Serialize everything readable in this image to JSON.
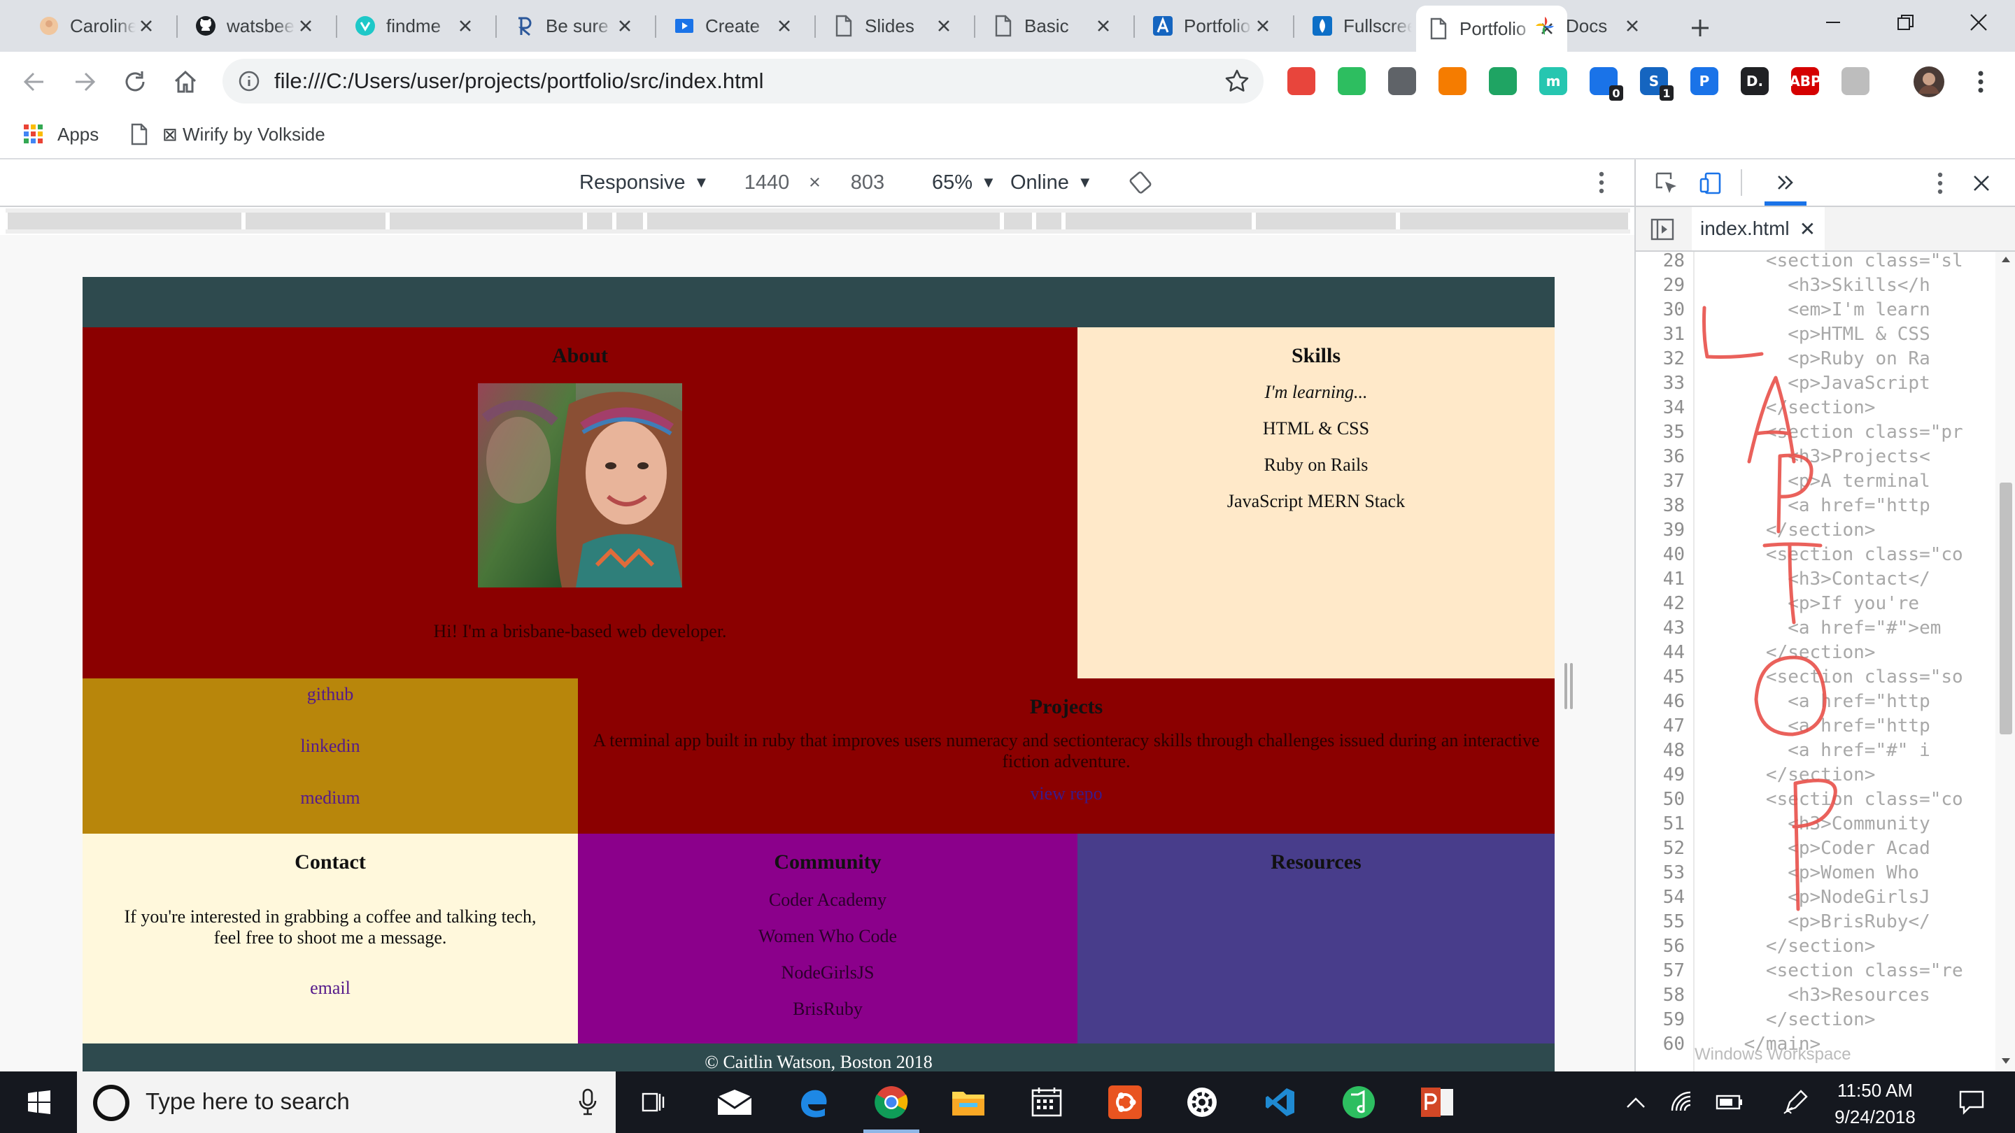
{
  "browser": {
    "tabs": [
      {
        "title": "Caroline",
        "icon": "avatar-favicon-icon"
      },
      {
        "title": "watsbeen",
        "icon": "github-icon"
      },
      {
        "title": "findme",
        "icon": "findme-favicon-icon"
      },
      {
        "title": "Be sure",
        "icon": "r-favicon-icon"
      },
      {
        "title": "Create",
        "icon": "video-favicon-icon"
      },
      {
        "title": "Slides",
        "icon": "page-icon"
      },
      {
        "title": "Basic",
        "icon": "page-icon"
      },
      {
        "title": "Portfolio",
        "icon": "a-favicon-icon"
      },
      {
        "title": "Fullscreen",
        "icon": "drop-favicon-icon"
      },
      {
        "title": "Portfolio",
        "icon": "page-icon",
        "active": true
      },
      {
        "title": "Docs",
        "icon": "pinwheel-favicon-icon"
      }
    ],
    "url": "file:///C:/Users/user/projects/portfolio/src/index.html",
    "bookmarks": [
      {
        "label": "Apps",
        "icon": "apps-grid-icon"
      },
      {
        "label": "⊠ Wirify by Volkside",
        "icon": "page-icon"
      }
    ],
    "extensions": [
      {
        "name": "stack-icon",
        "color": "#e8453c",
        "label": ""
      },
      {
        "name": "evernote-icon",
        "color": "#2dbe60",
        "label": ""
      },
      {
        "name": "pocket-icon",
        "color": "#5f6368",
        "label": ""
      },
      {
        "name": "flame-icon",
        "color": "#f57c00",
        "label": ""
      },
      {
        "name": "drive-icon",
        "color": "#1fa463",
        "label": ""
      },
      {
        "name": "mint-icon",
        "color": "#26c6b0",
        "label": "m"
      },
      {
        "name": "robot-icon",
        "color": "#1a73e8",
        "label": "",
        "badge": "0"
      },
      {
        "name": "skype-icon",
        "color": "#1565c0",
        "label": "S",
        "badge": "1"
      },
      {
        "name": "p-icon",
        "color": "#1a73e8",
        "label": "P"
      },
      {
        "name": "d-icon",
        "color": "#202124",
        "label": "D."
      },
      {
        "name": "abp-icon",
        "color": "#d50000",
        "label": "ABP"
      },
      {
        "name": "drive-grey-icon",
        "color": "#bdbdbd",
        "label": ""
      }
    ]
  },
  "device_toolbar": {
    "mode": "Responsive",
    "width": "1440",
    "times": "×",
    "height": "803",
    "zoom": "65%",
    "network": "Online"
  },
  "site": {
    "about": {
      "heading": "About",
      "tagline": "Hi! I'm a brisbane-based web developer."
    },
    "skills": {
      "heading": "Skills",
      "intro": "I'm learning...",
      "items": [
        "HTML & CSS",
        "Ruby on Rails",
        "JavaScript MERN Stack"
      ]
    },
    "links": [
      "github",
      "linkedin",
      "medium"
    ],
    "projects": {
      "heading": "Projects",
      "description": "A terminal app built in ruby that improves users numeracy and sectionteracy skills through challenges issued during an interactive fiction adventure.",
      "link": "view repo"
    },
    "contact": {
      "heading": "Contact",
      "text": "If you're interested in grabbing a coffee and talking tech, feel free to shoot me a message.",
      "link": "email"
    },
    "community": {
      "heading": "Community",
      "items": [
        "Coder Academy",
        "Women Who Code",
        "NodeGirlsJS",
        "BrisRuby"
      ]
    },
    "resources": {
      "heading": "Resources"
    },
    "footer": "© Caitlin Watson, Boston 2018"
  },
  "devtools": {
    "file_tab": "index.html",
    "first_line": 28,
    "lines": [
      "      <section class=\"sl",
      "        <h3>Skills</h",
      "        <em>I'm learn",
      "        <p>HTML & CSS",
      "        <p>Ruby on Ra",
      "        <p>JavaScript",
      "      </section>",
      "      <section class=\"pr",
      "        <h3>Projects<",
      "        <p>A terminal",
      "        <a href=\"http",
      "      </section>",
      "      <section class=\"co",
      "        <h3>Contact</",
      "        <p>If you're",
      "        <a href=\"#\">em",
      "      </section>",
      "      <section class=\"so",
      "        <a href=\"http",
      "        <a href=\"http",
      "        <a href=\"#\" i",
      "      </section>",
      "      <section class=\"co",
      "        <h3>Community",
      "        <p>Coder Acad",
      "        <p>Women Who",
      "        <p>NodeGirlsJ",
      "        <p>BrisRuby</",
      "      </section>",
      "      <section class=\"re",
      "        <h3>Resources",
      "      </section>",
      "    </main>"
    ],
    "workspace_hint": "Windows Workspace",
    "annotation": "LAPTOP"
  },
  "taskbar": {
    "search_placeholder": "Type here to search",
    "time": "11:50 AM",
    "date": "9/24/2018",
    "apps": [
      "task-view-icon",
      "mail-icon",
      "edge-icon",
      "chrome-icon",
      "file-explorer-icon",
      "calendar-icon",
      "ubuntu-icon",
      "settings-app-icon",
      "vscode-icon",
      "evernote-app-icon",
      "powerpoint-icon"
    ]
  }
}
